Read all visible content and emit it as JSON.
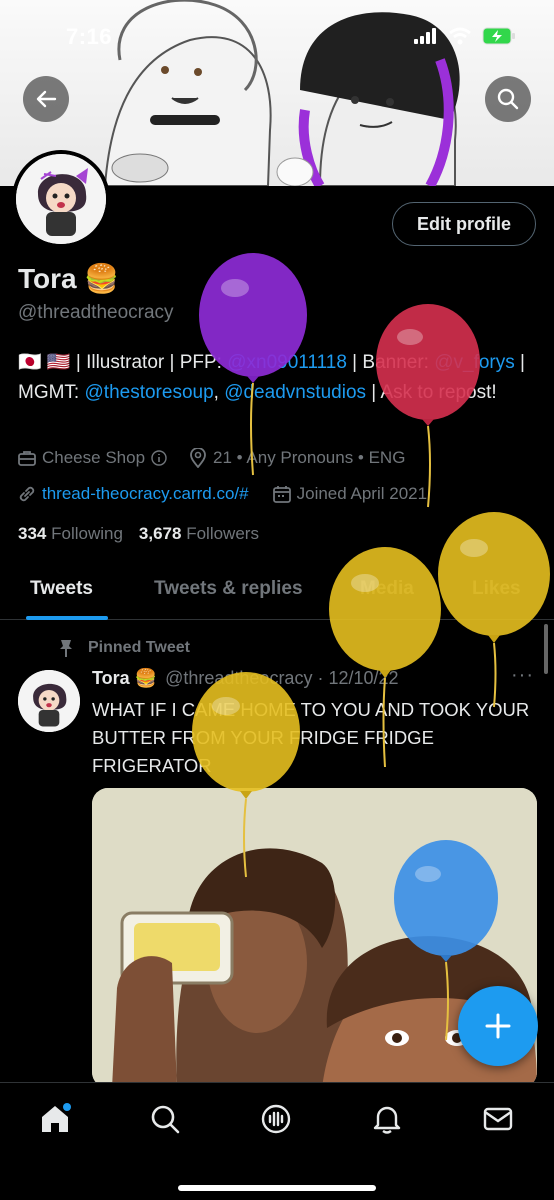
{
  "status_bar": {
    "time": "7:16"
  },
  "profile": {
    "name": "Tora 🍔",
    "handle": "@threadtheocracy",
    "edit_button": "Edit profile",
    "bio_flags": "🇯🇵 🇺🇸",
    "bio_text_1": " | Illustrator | PFP: ",
    "bio_link_1": "@xn09011118",
    "bio_text_2": " | Banner: ",
    "bio_link_2": "@v_forys",
    "bio_text_3": " | MGMT: ",
    "bio_link_3": "@thestoresoup",
    "bio_text_4": ", ",
    "bio_link_4": "@deadvnstudios",
    "bio_text_5": " | Ask to repost!",
    "category": "Cheese Shop",
    "location": "21 • Any Pronouns • ENG",
    "website": "thread-theocracy.carrd.co/#",
    "joined": "Joined April 2021",
    "following_count": "334",
    "following_label": "Following",
    "followers_count": "3,678",
    "followers_label": "Followers"
  },
  "tabs": [
    {
      "label": "Tweets"
    },
    {
      "label": "Tweets & replies"
    },
    {
      "label": "Media"
    },
    {
      "label": "Likes"
    }
  ],
  "tweet": {
    "pinned_label": "Pinned Tweet",
    "author": "Tora 🍔",
    "handle_date": "@threadtheocracy · 12/10/22",
    "more": "···",
    "text": "WHAT IF I CAME HOME TO YOU AND TOOK YOUR BUTTER FROM YOUR FRIDGE FRIDGE FRIGERATOR"
  },
  "colors": {
    "accent": "#1d9bf0",
    "background": "#000000",
    "balloon_purple": "#8d2bd6",
    "balloon_red": "#d6304f",
    "balloon_yellow": "#e5bf1f",
    "balloon_blue": "#3c8fe6"
  },
  "icons": {
    "back": "back-arrow-icon",
    "search": "search-icon",
    "info": "info-icon",
    "location": "location-icon",
    "link": "link-icon",
    "calendar": "calendar-icon",
    "briefcase": "briefcase-icon",
    "pin": "pin-icon",
    "compose": "compose-plus-icon",
    "home": "home-icon",
    "explore": "search-icon",
    "spaces": "spaces-icon",
    "notifications": "bell-icon",
    "messages": "mail-icon"
  }
}
